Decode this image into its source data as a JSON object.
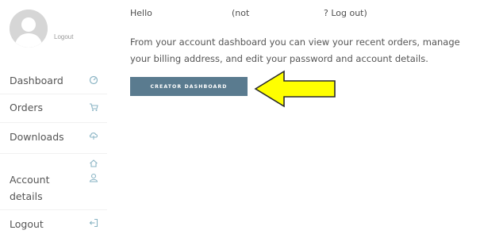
{
  "sidebar": {
    "avatar_logout": "Logout",
    "items": [
      {
        "label": "Dashboard",
        "icon": "dashboard-icon"
      },
      {
        "label": "Orders",
        "icon": "cart-icon"
      },
      {
        "label": "Downloads",
        "icon": "cloud-download-icon"
      },
      {
        "label": "Account details",
        "icon": "user-icon",
        "extra_icon": "home-icon"
      },
      {
        "label": "Logout",
        "icon": "logout-icon"
      }
    ]
  },
  "main": {
    "hello": "Hello",
    "not": "(not",
    "logout_link": "? Log out)",
    "intro_line1": "From your account dashboard you can view your recent orders, manage",
    "intro_line2": "your billing address, and edit your password and account details.",
    "creator_button": "CREATOR DASHBOARD"
  },
  "annotation": {
    "arrow_color": "#ffff00",
    "arrow_outline": "#2a2a2a"
  },
  "colors": {
    "button_bg": "#5a7b8f",
    "icon_color": "#8ab4c4"
  }
}
